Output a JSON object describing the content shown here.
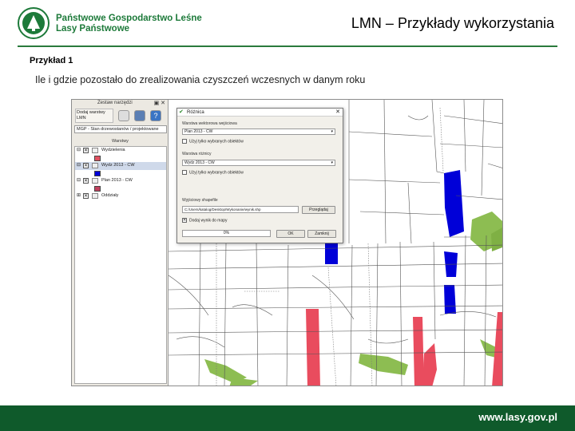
{
  "header": {
    "org_line1": "Państwowe Gospodarstwo Leśne",
    "org_line2": "Lasy Państwowe",
    "title": "LMN – Przykłady wykorzystania"
  },
  "section": {
    "heading": "Przykład 1",
    "subtitle": "Ile i gdzie pozostało do zrealizowania czyszczeń wczesnych w danym roku"
  },
  "qgis_panel": {
    "toolbar_title": "Zestaw narzędzi",
    "add_layers_label": "Dodaj warstwy LMN",
    "combo_value": "MGP - Stan drzewostanów / projektowane",
    "layers_title": "Warstwy",
    "layers": [
      {
        "name": "Wydzielenia",
        "selected": false
      },
      {
        "name": "Wydz 2013 - CW",
        "selected": true
      },
      {
        "name": "Plan 2013 - CW",
        "selected": false
      },
      {
        "name": "Oddziały",
        "selected": false
      }
    ],
    "swatch_colors": [
      "#e05060",
      "#0000d8",
      "#c0405e"
    ]
  },
  "dialog": {
    "title": "Różnica",
    "input_label": "Warstwa wektorowa wejściowa",
    "input_value": "Plan 2013 - CW",
    "input_checkbox": "Użyj tylko wybranych obiektów",
    "diff_label": "Warstwa różnicy",
    "diff_value": "Wydz 2013 - CW",
    "diff_checkbox": "Użyj tylko wybranych obiektów",
    "output_label": "Wyjściowy shapefile",
    "output_path": "C:/Users/katalog/Desktop/Wykonanie/wynik.shp",
    "browse_label": "Przeglądaj",
    "add_result_label": "Dodaj wynik do mapy",
    "progress": "0%",
    "ok_label": "OK",
    "close_label": "Zamknij"
  },
  "footer": {
    "url": "www.lasy.gov.pl"
  },
  "colors": {
    "brand_green": "#0f5a2b",
    "logo_green": "#1d7a3a",
    "pending_blue": "#0000d8",
    "pending_red": "#e94c5e",
    "meadow_green": "#8dbd52"
  }
}
